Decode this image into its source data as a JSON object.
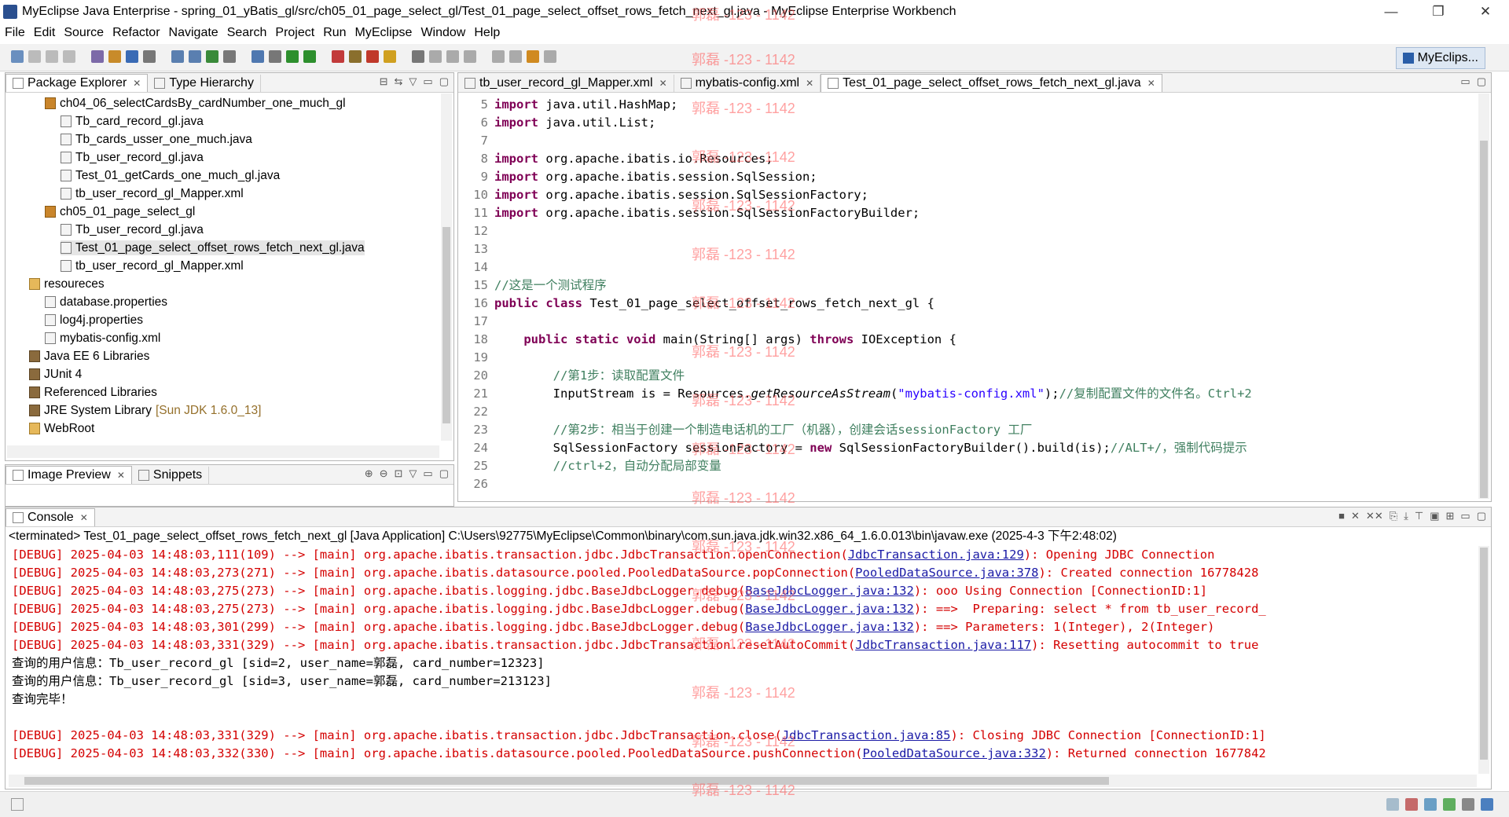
{
  "window": {
    "title": "MyEclipse Java Enterprise - spring_01_yBatis_gl/src/ch05_01_page_select_gl/Test_01_page_select_offset_rows_fetch_next_gl.java - MyEclipse Enterprise Workbench",
    "minimize": "—",
    "maximize": "❐",
    "close": "✕"
  },
  "menu": [
    "File",
    "Edit",
    "Source",
    "Refactor",
    "Navigate",
    "Search",
    "Project",
    "Run",
    "MyEclipse",
    "Window",
    "Help"
  ],
  "perspective": {
    "label": "MyEclips..."
  },
  "package_explorer": {
    "tabs": [
      "Package Explorer",
      "Type Hierarchy"
    ],
    "items": [
      {
        "label": "ch04_06_selectCardsBy_cardNumber_one_much_gl",
        "icon": "package-icon"
      },
      {
        "label": "Tb_card_record_gl.java",
        "icon": "java-file-icon"
      },
      {
        "label": "Tb_cards_usser_one_much.java",
        "icon": "java-file-icon"
      },
      {
        "label": "Tb_user_record_gl.java",
        "icon": "java-file-icon"
      },
      {
        "label": "Test_01_getCards_one_much_gl.java",
        "icon": "java-file-icon"
      },
      {
        "label": "tb_user_record_gl_Mapper.xml",
        "icon": "xml-file-icon"
      },
      {
        "label": "ch05_01_page_select_gl",
        "icon": "package-icon"
      },
      {
        "label": "Tb_user_record_gl.java",
        "icon": "java-file-icon"
      },
      {
        "label": "Test_01_page_select_offset_rows_fetch_next_gl.java",
        "icon": "java-file-icon"
      },
      {
        "label": "tb_user_record_gl_Mapper.xml",
        "icon": "xml-file-icon"
      },
      {
        "label": "resoureces",
        "icon": "folder-icon"
      },
      {
        "label": "database.properties",
        "icon": "properties-icon"
      },
      {
        "label": "log4j.properties",
        "icon": "properties-icon"
      },
      {
        "label": "mybatis-config.xml",
        "icon": "xml-file-icon"
      },
      {
        "label": "Java EE 6 Libraries",
        "icon": "library-icon"
      },
      {
        "label": "JUnit 4",
        "icon": "library-icon"
      },
      {
        "label": "Referenced Libraries",
        "icon": "library-icon"
      },
      {
        "label": "JRE System Library",
        "icon": "library-icon",
        "suffix": "[Sun JDK 1.6.0_13]"
      },
      {
        "label": "WebRoot",
        "icon": "folder-icon"
      }
    ]
  },
  "image_preview": {
    "tabs": [
      "Image Preview",
      "Snippets"
    ]
  },
  "editor": {
    "tabs": [
      "tb_user_record_gl_Mapper.xml",
      "mybatis-config.xml",
      "Test_01_page_select_offset_rows_fetch_next_gl.java"
    ],
    "lines": [
      {
        "n": "5",
        "segs": [
          [
            "kw",
            "import"
          ],
          [
            "plain",
            " java.util.HashMap;"
          ]
        ]
      },
      {
        "n": "6",
        "segs": [
          [
            "kw",
            "import"
          ],
          [
            "plain",
            " java.util.List;"
          ]
        ]
      },
      {
        "n": "7",
        "segs": []
      },
      {
        "n": "8",
        "segs": [
          [
            "kw",
            "import"
          ],
          [
            "plain",
            " org.apache.ibatis.io.Resources;"
          ]
        ]
      },
      {
        "n": "9",
        "segs": [
          [
            "kw",
            "import"
          ],
          [
            "plain",
            " org.apache.ibatis.session.SqlSession;"
          ]
        ]
      },
      {
        "n": "10",
        "segs": [
          [
            "kw",
            "import"
          ],
          [
            "plain",
            " org.apache.ibatis.session.SqlSessionFactory;"
          ]
        ]
      },
      {
        "n": "11",
        "segs": [
          [
            "kw",
            "import"
          ],
          [
            "plain",
            " org.apache.ibatis.session.SqlSessionFactoryBuilder;"
          ]
        ]
      },
      {
        "n": "12",
        "segs": []
      },
      {
        "n": "13",
        "segs": []
      },
      {
        "n": "14",
        "segs": []
      },
      {
        "n": "15",
        "segs": [
          [
            "cm",
            "//这是一个测试程序"
          ]
        ]
      },
      {
        "n": "16",
        "segs": [
          [
            "kw",
            "public class"
          ],
          [
            "plain",
            " Test_01_page_select_offset_rows_fetch_next_gl {"
          ]
        ]
      },
      {
        "n": "17",
        "segs": []
      },
      {
        "n": "18",
        "segs": [
          [
            "plain",
            "    "
          ],
          [
            "kw",
            "public static void"
          ],
          [
            "plain",
            " main(String[] args) "
          ],
          [
            "kw",
            "throws"
          ],
          [
            "plain",
            " IOException {"
          ]
        ]
      },
      {
        "n": "19",
        "segs": []
      },
      {
        "n": "20",
        "segs": [
          [
            "plain",
            "        "
          ],
          [
            "cm",
            "//第1步：读取配置文件"
          ]
        ]
      },
      {
        "n": "21",
        "segs": [
          [
            "plain",
            "        InputStream is = Resources."
          ],
          [
            "it",
            "getResourceAsStream"
          ],
          [
            "plain",
            "("
          ],
          [
            "str",
            "\"mybatis-config.xml\""
          ],
          [
            "plain",
            ");"
          ],
          [
            "cm",
            "//复制配置文件的文件名。Ctrl+2"
          ]
        ]
      },
      {
        "n": "22",
        "segs": []
      },
      {
        "n": "23",
        "segs": [
          [
            "plain",
            "        "
          ],
          [
            "cm",
            "//第2步：相当于创建一个制造电话机的工厂（机器），创建会话sessionFactory 工厂"
          ]
        ]
      },
      {
        "n": "24",
        "segs": [
          [
            "plain",
            "        SqlSessionFactory sessionFactory = "
          ],
          [
            "kw",
            "new"
          ],
          [
            "plain",
            " SqlSessionFactoryBuilder().build(is);"
          ],
          [
            "cm",
            "//ALT+/，强制代码提示"
          ]
        ]
      },
      {
        "n": "25",
        "segs": [
          [
            "plain",
            "        "
          ],
          [
            "cm",
            "//ctrl+2，自动分配局部变量"
          ]
        ]
      },
      {
        "n": "26",
        "segs": []
      }
    ]
  },
  "console": {
    "tab": "Console",
    "header": "<terminated> Test_01_page_select_offset_rows_fetch_next_gl [Java Application] C:\\Users\\92775\\MyEclipse\\Common\\binary\\com.sun.java.jdk.win32.x86_64_1.6.0.013\\bin\\javaw.exe (2025-4-3 下午2:48:02)",
    "lines": [
      {
        "segs": [
          [
            "dbg",
            "[DEBUG] 2025-04-03 14:48:03,111(109) --> [main] org.apache.ibatis.transaction.jdbc.JdbcTransaction.openConnection("
          ],
          [
            "lnk",
            "JdbcTransaction.java:129"
          ],
          [
            "dbg",
            "): Opening JDBC Connection"
          ]
        ]
      },
      {
        "segs": [
          [
            "dbg",
            "[DEBUG] 2025-04-03 14:48:03,273(271) --> [main] org.apache.ibatis.datasource.pooled.PooledDataSource.popConnection("
          ],
          [
            "lnk",
            "PooledDataSource.java:378"
          ],
          [
            "dbg",
            "): Created connection 16778428"
          ]
        ]
      },
      {
        "segs": [
          [
            "dbg",
            "[DEBUG] 2025-04-03 14:48:03,275(273) --> [main] org.apache.ibatis.logging.jdbc.BaseJdbcLogger.debug("
          ],
          [
            "lnk",
            "BaseJdbcLogger.java:132"
          ],
          [
            "dbg",
            "): ooo Using Connection [ConnectionID:1]"
          ]
        ]
      },
      {
        "segs": [
          [
            "dbg",
            "[DEBUG] 2025-04-03 14:48:03,275(273) --> [main] org.apache.ibatis.logging.jdbc.BaseJdbcLogger.debug("
          ],
          [
            "lnk",
            "BaseJdbcLogger.java:132"
          ],
          [
            "dbg",
            "): ==>  Preparing: select * from tb_user_record_"
          ]
        ]
      },
      {
        "segs": [
          [
            "dbg",
            "[DEBUG] 2025-04-03 14:48:03,301(299) --> [main] org.apache.ibatis.logging.jdbc.BaseJdbcLogger.debug("
          ],
          [
            "lnk",
            "BaseJdbcLogger.java:132"
          ],
          [
            "dbg",
            "): ==> Parameters: 1(Integer), 2(Integer)"
          ]
        ]
      },
      {
        "segs": [
          [
            "dbg",
            "[DEBUG] 2025-04-03 14:48:03,331(329) --> [main] org.apache.ibatis.transaction.jdbc.JdbcTransaction.resetAutoCommit("
          ],
          [
            "lnk",
            "JdbcTransaction.java:117"
          ],
          [
            "dbg",
            "): Resetting autocommit to true"
          ]
        ]
      },
      {
        "segs": [
          [
            "plain",
            "查询的用户信息：Tb_user_record_gl [sid=2, user_name=郭磊, card_number=12323]"
          ]
        ]
      },
      {
        "segs": [
          [
            "plain",
            "查询的用户信息：Tb_user_record_gl [sid=3, user_name=郭磊, card_number=213123]"
          ]
        ]
      },
      {
        "segs": [
          [
            "plain",
            "查询完毕！"
          ]
        ]
      },
      {
        "segs": [
          [
            "dbg",
            "[DEBUG] 2025-04-03 14:48:03,331(329) --> [main] org.apache.ibatis.transaction.jdbc.JdbcTransaction.close("
          ],
          [
            "lnk",
            "JdbcTransaction.java:85"
          ],
          [
            "dbg",
            "): Closing JDBC Connection [ConnectionID:1]"
          ]
        ]
      },
      {
        "segs": [
          [
            "dbg",
            "[DEBUG] 2025-04-03 14:48:03,332(330) --> [main] org.apache.ibatis.datasource.pooled.PooledDataSource.pushConnection("
          ],
          [
            "lnk",
            "PooledDataSource.java:332"
          ],
          [
            "dbg",
            "): Returned connection 1677842"
          ]
        ]
      }
    ]
  },
  "watermark": "郭磊 -123 - 1142"
}
